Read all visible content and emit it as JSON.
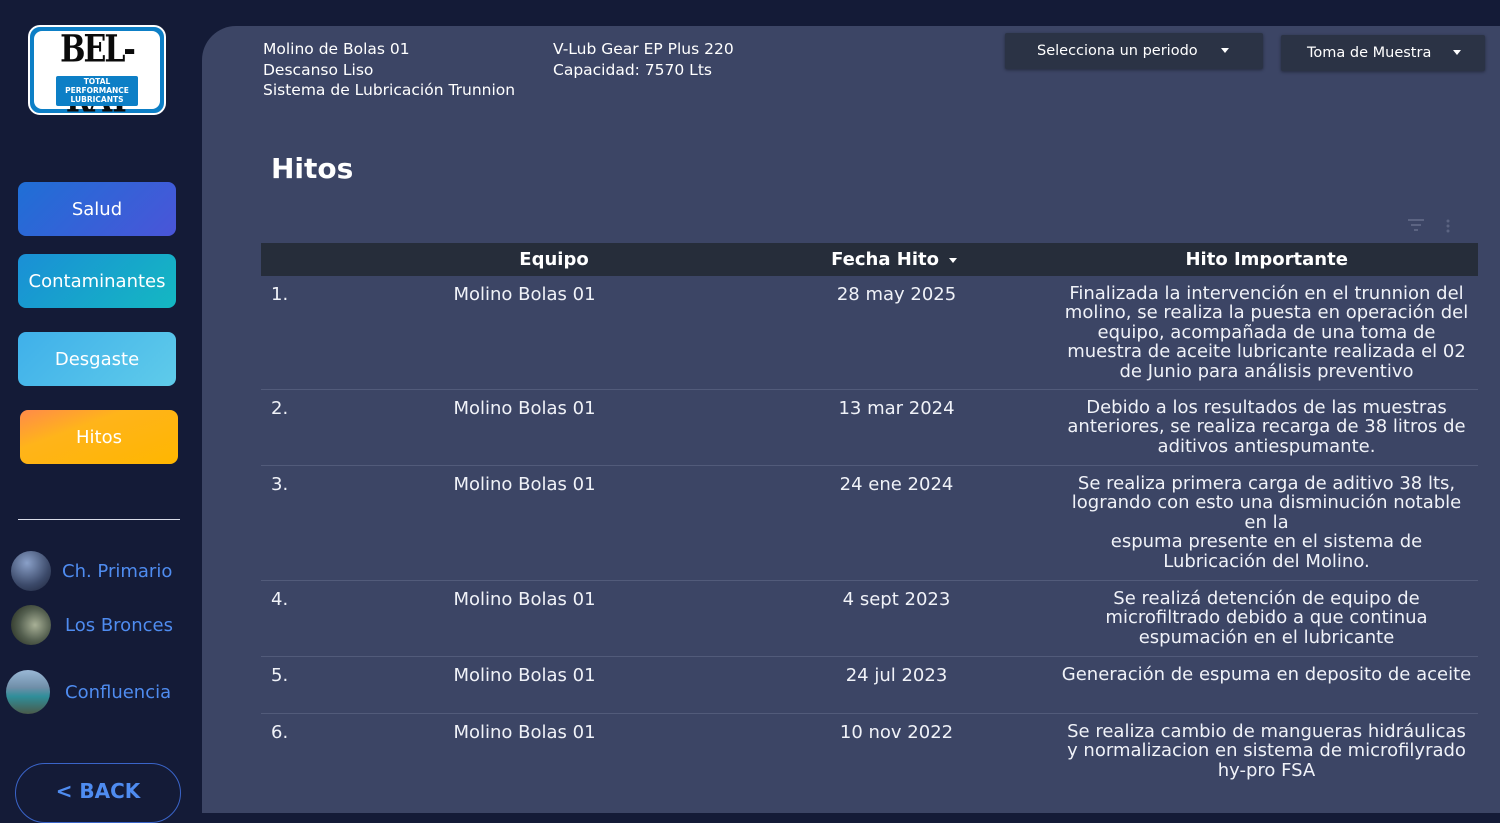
{
  "brand": {
    "logo_main": "BEL-RAY",
    "logo_sub": "TOTAL PERFORMANCE LUBRICANTS"
  },
  "nav": {
    "salud": "Salud",
    "contaminantes": "Contaminantes",
    "desgaste": "Desgaste",
    "hitos": "Hitos"
  },
  "sites": {
    "primario": "Ch. Primario",
    "bronces": "Los Bronces",
    "confluencia": "Confluencia"
  },
  "back_label": "< BACK",
  "header": {
    "equipo": "Molino de Bolas 01",
    "componente": "Descanso Liso",
    "sistema": "Sistema de Lubricación Trunnion",
    "lubricante": "V-Lub Gear EP Plus 220",
    "capacidad": "Capacidad: 7570 Lts"
  },
  "filters": {
    "periodo": "Selecciona un periodo",
    "toma": "Toma de Muestra"
  },
  "page_title": "Hitos",
  "table": {
    "headers": {
      "equipo": "Equipo",
      "fecha": "Fecha Hito",
      "hito": "Hito Importante"
    },
    "rows": [
      {
        "num": "1.",
        "equipo": "Molino Bolas 01",
        "fecha": "28 may 2025",
        "hito": "Finalizada la intervención en el trunnion del molino, se realiza la puesta en operación del equipo, acompañada de una toma de muestra de aceite lubricante realizada el 02 de Junio para análisis preventivo"
      },
      {
        "num": "2.",
        "equipo": "Molino Bolas 01",
        "fecha": "13 mar 2024",
        "hito": "Debido a los resultados de las muestras anteriores, se realiza recarga de 38 litros de aditivos antiespumante."
      },
      {
        "num": "3.",
        "equipo": "Molino Bolas 01",
        "fecha": "24 ene 2024",
        "hito": "Se realiza primera carga de aditivo 38 lts, logrando con esto una disminución notable en la\nespuma presente en el sistema de Lubricación del Molino."
      },
      {
        "num": "4.",
        "equipo": "Molino Bolas 01",
        "fecha": "4 sept 2023",
        "hito": "Se realizá detención de equipo de microfiltrado debido a que continua espumación en el lubricante"
      },
      {
        "num": "5.",
        "equipo": "Molino Bolas 01",
        "fecha": "24 jul 2023",
        "hito": "Generación de espuma en deposito de aceite"
      },
      {
        "num": "6.",
        "equipo": "Molino Bolas 01",
        "fecha": "10 nov 2022",
        "hito": "Se realiza cambio de mangueras hidráulicas y normalizacion en sistema de microfilyrado hy-pro FSA"
      }
    ]
  },
  "colors": {
    "sidebar_bg": "#141b37",
    "main_bg": "#3c4565",
    "header_row_bg": "#262d3a",
    "active_nav": "#ffb600",
    "link_blue": "#4f8cf0"
  }
}
